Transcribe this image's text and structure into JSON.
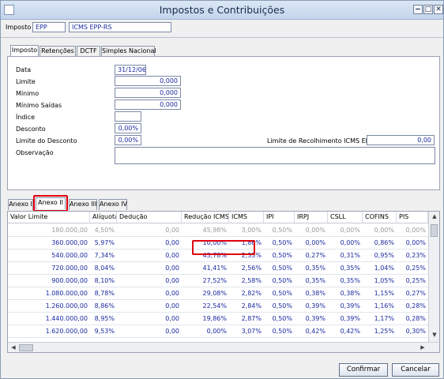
{
  "window": {
    "title": "Impostos e Contribuições",
    "controls": [
      "minimize-icon",
      "restore-icon",
      "close-icon"
    ]
  },
  "header": {
    "imposto_label": "Imposto",
    "imposto_code": "EPP",
    "imposto_desc": "ICMS EPP-RS"
  },
  "top_tabs": [
    "Imposto",
    "Retenções",
    "DCTF",
    "Simples Nacional"
  ],
  "form": {
    "data_label": "Data",
    "data_value": "31/12/06",
    "limite_label": "Limite",
    "limite_value": "0,000",
    "minimo_label": "Mínimo",
    "minimo_value": "0,000",
    "minimo_saidas_label": "Mínimo Saídas",
    "minimo_saidas_value": "0,000",
    "indice_label": "Índice",
    "indice_value": "",
    "desconto_label": "Desconto",
    "desconto_value": "0,00%",
    "limite_desconto_label": "Limite do Desconto",
    "limite_desconto_value": "0,00%",
    "limite_recolhimento_label": "Limite de Recolhimento ICMS EPP",
    "limite_recolhimento_value": "0,00",
    "observacao_label": "Observação",
    "observacao_value": ""
  },
  "anexo_tabs": [
    "Anexo I",
    "Anexo II",
    "Anexo III",
    "Anexo IV"
  ],
  "grid": {
    "columns": [
      "Valor Limite",
      "Alíquota",
      "Dedução",
      "Redução ICMS",
      "ICMS",
      "IPI",
      "IRPJ",
      "CSLL",
      "COFINS",
      "PIS"
    ],
    "rows": [
      [
        "180.000,00",
        "4,50%",
        "0,00",
        "45,98%",
        "3,00%",
        "0,50%",
        "0,00%",
        "0,00%",
        "0,00%",
        "0,00%"
      ],
      [
        "360.000,00",
        "5,97%",
        "0,00",
        "10,00%",
        "1,86%",
        "0,50%",
        "0,00%",
        "0,00%",
        "0,86%",
        "0,00%"
      ],
      [
        "540.000,00",
        "7,34%",
        "0,00",
        "43,78%",
        "2,33%",
        "0,50%",
        "0,27%",
        "0,31%",
        "0,95%",
        "0,23%"
      ],
      [
        "720.000,00",
        "8,04%",
        "0,00",
        "41,41%",
        "2,56%",
        "0,50%",
        "0,35%",
        "0,35%",
        "1,04%",
        "0,25%"
      ],
      [
        "900.000,00",
        "8,10%",
        "0,00",
        "27,52%",
        "2,58%",
        "0,50%",
        "0,35%",
        "0,35%",
        "1,05%",
        "0,25%"
      ],
      [
        "1.080.000,00",
        "8,78%",
        "0,00",
        "29,08%",
        "2,82%",
        "0,50%",
        "0,38%",
        "0,38%",
        "1,15%",
        "0,27%"
      ],
      [
        "1.260.000,00",
        "8,86%",
        "0,00",
        "22,54%",
        "2,84%",
        "0,50%",
        "0,39%",
        "0,39%",
        "1,16%",
        "0,28%"
      ],
      [
        "1.440.000,00",
        "8,95%",
        "0,00",
        "19,86%",
        "2,87%",
        "0,50%",
        "0,39%",
        "0,39%",
        "1,17%",
        "0,28%"
      ],
      [
        "1.620.000,00",
        "9,53%",
        "0,00",
        "0,00%",
        "3,07%",
        "0,50%",
        "0,42%",
        "0,42%",
        "1,25%",
        "0,30%"
      ]
    ]
  },
  "buttons": {
    "confirm": "Confirmar",
    "cancel": "Cancelar"
  },
  "colors": {
    "value_text": "#1a2aa0",
    "highlight_border": "#e00010",
    "titlebar": "#c3d5ec"
  }
}
